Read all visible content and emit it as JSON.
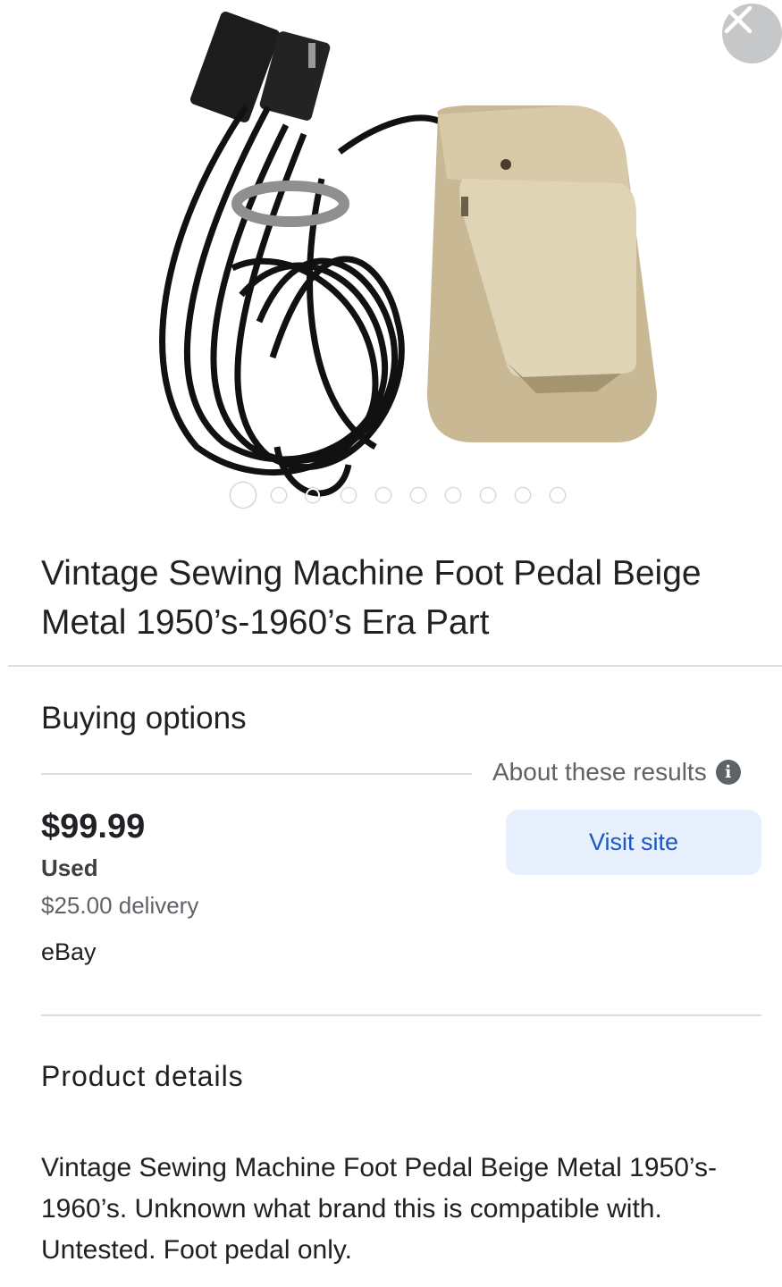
{
  "gallery": {
    "image_alt": "Vintage beige sewing machine foot pedal with black cord",
    "dot_count": 10,
    "active_index": 0
  },
  "product": {
    "title": "Vintage Sewing Machine Foot Pedal Beige Metal 1950’s-1960’s Era Part"
  },
  "buying_options": {
    "heading": "Buying options",
    "about_label": "About these results",
    "offer": {
      "price": "$99.99",
      "condition": "Used",
      "delivery": "$25.00 delivery",
      "seller": "eBay",
      "visit_label": "Visit site"
    }
  },
  "details": {
    "heading": "Product details",
    "body": "Vintage Sewing Machine Foot Pedal Beige Metal 1950’s-1960’s. Unknown what brand this is compatible with. Untested. Foot pedal only."
  },
  "colors": {
    "accent": "#1a56c4",
    "button_bg": "#e8f0fe",
    "divider": "#dadce0"
  }
}
